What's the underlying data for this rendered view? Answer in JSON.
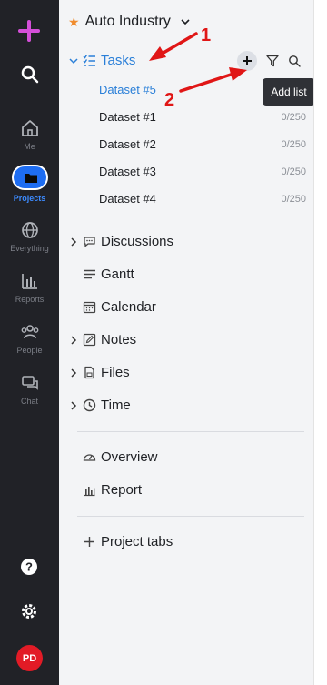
{
  "rail": {
    "items": [
      {
        "label": "Me",
        "icon": "home-icon"
      },
      {
        "label": "Projects",
        "icon": "folder-icon",
        "active": true
      },
      {
        "label": "Everything",
        "icon": "globe-icon"
      },
      {
        "label": "Reports",
        "icon": "bar-chart-icon"
      },
      {
        "label": "People",
        "icon": "people-icon"
      },
      {
        "label": "Chat",
        "icon": "chat-icon"
      }
    ],
    "avatar_initials": "PD",
    "accent": "#d54fd9",
    "active_color": "#1e6df2"
  },
  "sidebar": {
    "project_name": "Auto Industry",
    "tasks_label": "Tasks",
    "tooltip": "Add list",
    "datasets": [
      {
        "name": "Dataset #5",
        "count": "",
        "active": true
      },
      {
        "name": "Dataset #1",
        "count": "0/250"
      },
      {
        "name": "Dataset #2",
        "count": "0/250"
      },
      {
        "name": "Dataset #3",
        "count": "0/250"
      },
      {
        "name": "Dataset #4",
        "count": "0/250"
      }
    ],
    "sections": [
      {
        "label": "Discussions"
      },
      {
        "label": "Gantt"
      },
      {
        "label": "Calendar"
      },
      {
        "label": "Notes"
      },
      {
        "label": "Files"
      },
      {
        "label": "Time"
      }
    ],
    "extras": [
      {
        "label": "Overview"
      },
      {
        "label": "Report"
      }
    ],
    "add_tabs": "Project tabs"
  },
  "annotations": {
    "first": "1",
    "second": "2"
  }
}
